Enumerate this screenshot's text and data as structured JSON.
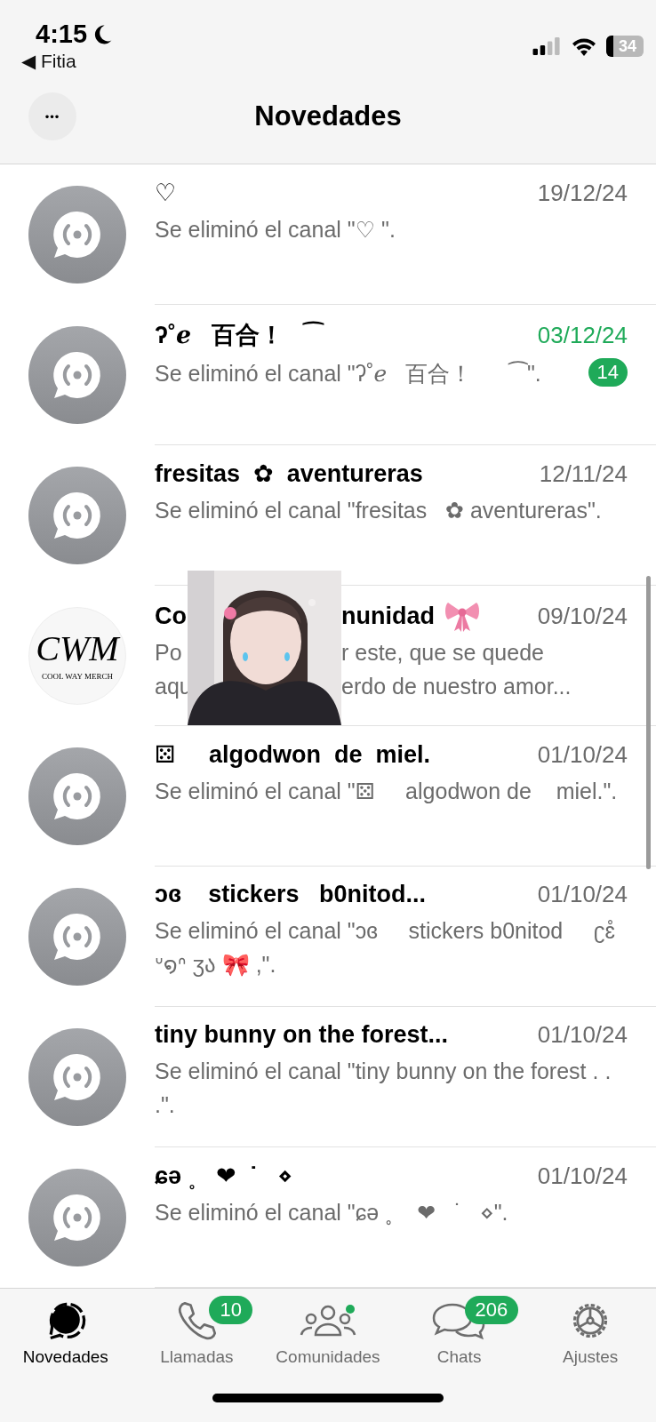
{
  "status_bar": {
    "time": "4:15",
    "back_label": "◀ Fitia",
    "battery": "34"
  },
  "header": {
    "title": "Novedades",
    "more_button": "•••"
  },
  "rows": [
    {
      "kind": "channel",
      "title": "♡",
      "date": "19/12/24",
      "unread": false,
      "preview": "Se eliminó el canal \"♡ \"."
    },
    {
      "kind": "channel",
      "title": "ʔ˚ℯ   百合！   ⁀",
      "date": "03/12/24",
      "unread": true,
      "badge": "14",
      "preview": "Se eliminó el canal \"ʔ˚ℯ   百合！      ⁀\"."
    },
    {
      "kind": "channel",
      "title": "fresitas  ✿  aventureras",
      "date": "12/11/24",
      "unread": false,
      "preview": "Se eliminó el canal \"fresitas   ✿ aventureras\"."
    },
    {
      "kind": "covered",
      "logo_text": "CWM",
      "logo_caption": "COOL WAY MERCH",
      "title_parts": [
        "Co",
        "nunidad"
      ],
      "date": "09/10/24",
      "unread": false,
      "preview_lines": [
        [
          "Po",
          "r este, que se quede"
        ],
        [
          "aqu",
          "erdo de nuestro amor..."
        ]
      ]
    },
    {
      "kind": "channel",
      "title": "⚄     algodwon  de  miel.",
      "date": "01/10/24",
      "unread": false,
      "preview": "Se eliminó el canal \"⚄     algodwon de    miel.\"."
    },
    {
      "kind": "channel",
      "title": "ɔɞ    stickers   b0nitod...",
      "date": "01/10/24",
      "unread": false,
      "preview": "Se eliminó el canal \"ɔɞ     stickers b0nitod     ʗɛ̊ ᐡ໑ᐢ ʒა 🎀 ,\"."
    },
    {
      "kind": "channel",
      "title": "tiny bunny on the forest...",
      "date": "01/10/24",
      "unread": false,
      "preview": "Se eliminó el canal \"tiny bunny on the forest . . .\"."
    },
    {
      "kind": "channel",
      "title": "ɕə ˳   ❤  ˙   ⋄",
      "date": "01/10/24",
      "unread": false,
      "preview": "Se eliminó el canal \"ɕə ˳    ❤   ˙   ⋄\"."
    }
  ],
  "tabs": [
    {
      "label": "Novedades",
      "kind": "updates",
      "selected": true
    },
    {
      "label": "Llamadas",
      "kind": "calls",
      "selected": false,
      "badge": "10"
    },
    {
      "label": "Comunidades",
      "kind": "communities",
      "selected": false,
      "dot": true
    },
    {
      "label": "Chats",
      "kind": "chats",
      "selected": false,
      "badge": "206"
    },
    {
      "label": "Ajustes",
      "kind": "settings",
      "selected": false
    }
  ]
}
